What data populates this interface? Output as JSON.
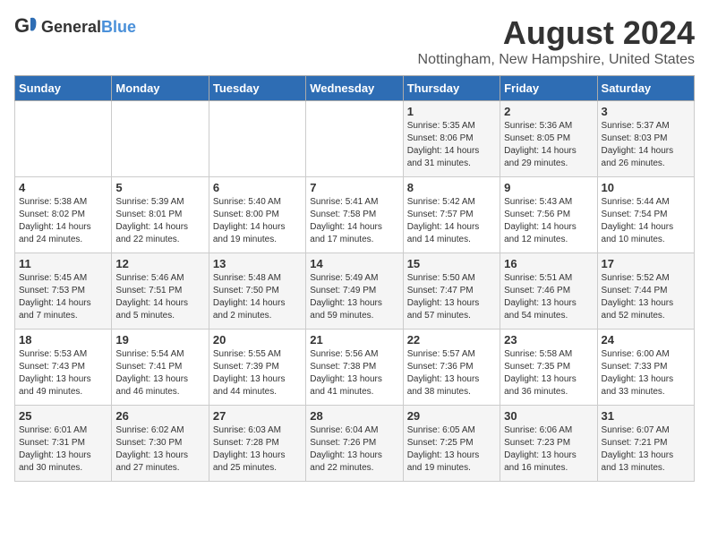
{
  "header": {
    "logo_general": "General",
    "logo_blue": "Blue",
    "month": "August 2024",
    "location": "Nottingham, New Hampshire, United States"
  },
  "weekdays": [
    "Sunday",
    "Monday",
    "Tuesday",
    "Wednesday",
    "Thursday",
    "Friday",
    "Saturday"
  ],
  "weeks": [
    [
      {
        "day": "",
        "info": ""
      },
      {
        "day": "",
        "info": ""
      },
      {
        "day": "",
        "info": ""
      },
      {
        "day": "",
        "info": ""
      },
      {
        "day": "1",
        "info": "Sunrise: 5:35 AM\nSunset: 8:06 PM\nDaylight: 14 hours\nand 31 minutes."
      },
      {
        "day": "2",
        "info": "Sunrise: 5:36 AM\nSunset: 8:05 PM\nDaylight: 14 hours\nand 29 minutes."
      },
      {
        "day": "3",
        "info": "Sunrise: 5:37 AM\nSunset: 8:03 PM\nDaylight: 14 hours\nand 26 minutes."
      }
    ],
    [
      {
        "day": "4",
        "info": "Sunrise: 5:38 AM\nSunset: 8:02 PM\nDaylight: 14 hours\nand 24 minutes."
      },
      {
        "day": "5",
        "info": "Sunrise: 5:39 AM\nSunset: 8:01 PM\nDaylight: 14 hours\nand 22 minutes."
      },
      {
        "day": "6",
        "info": "Sunrise: 5:40 AM\nSunset: 8:00 PM\nDaylight: 14 hours\nand 19 minutes."
      },
      {
        "day": "7",
        "info": "Sunrise: 5:41 AM\nSunset: 7:58 PM\nDaylight: 14 hours\nand 17 minutes."
      },
      {
        "day": "8",
        "info": "Sunrise: 5:42 AM\nSunset: 7:57 PM\nDaylight: 14 hours\nand 14 minutes."
      },
      {
        "day": "9",
        "info": "Sunrise: 5:43 AM\nSunset: 7:56 PM\nDaylight: 14 hours\nand 12 minutes."
      },
      {
        "day": "10",
        "info": "Sunrise: 5:44 AM\nSunset: 7:54 PM\nDaylight: 14 hours\nand 10 minutes."
      }
    ],
    [
      {
        "day": "11",
        "info": "Sunrise: 5:45 AM\nSunset: 7:53 PM\nDaylight: 14 hours\nand 7 minutes."
      },
      {
        "day": "12",
        "info": "Sunrise: 5:46 AM\nSunset: 7:51 PM\nDaylight: 14 hours\nand 5 minutes."
      },
      {
        "day": "13",
        "info": "Sunrise: 5:48 AM\nSunset: 7:50 PM\nDaylight: 14 hours\nand 2 minutes."
      },
      {
        "day": "14",
        "info": "Sunrise: 5:49 AM\nSunset: 7:49 PM\nDaylight: 13 hours\nand 59 minutes."
      },
      {
        "day": "15",
        "info": "Sunrise: 5:50 AM\nSunset: 7:47 PM\nDaylight: 13 hours\nand 57 minutes."
      },
      {
        "day": "16",
        "info": "Sunrise: 5:51 AM\nSunset: 7:46 PM\nDaylight: 13 hours\nand 54 minutes."
      },
      {
        "day": "17",
        "info": "Sunrise: 5:52 AM\nSunset: 7:44 PM\nDaylight: 13 hours\nand 52 minutes."
      }
    ],
    [
      {
        "day": "18",
        "info": "Sunrise: 5:53 AM\nSunset: 7:43 PM\nDaylight: 13 hours\nand 49 minutes."
      },
      {
        "day": "19",
        "info": "Sunrise: 5:54 AM\nSunset: 7:41 PM\nDaylight: 13 hours\nand 46 minutes."
      },
      {
        "day": "20",
        "info": "Sunrise: 5:55 AM\nSunset: 7:39 PM\nDaylight: 13 hours\nand 44 minutes."
      },
      {
        "day": "21",
        "info": "Sunrise: 5:56 AM\nSunset: 7:38 PM\nDaylight: 13 hours\nand 41 minutes."
      },
      {
        "day": "22",
        "info": "Sunrise: 5:57 AM\nSunset: 7:36 PM\nDaylight: 13 hours\nand 38 minutes."
      },
      {
        "day": "23",
        "info": "Sunrise: 5:58 AM\nSunset: 7:35 PM\nDaylight: 13 hours\nand 36 minutes."
      },
      {
        "day": "24",
        "info": "Sunrise: 6:00 AM\nSunset: 7:33 PM\nDaylight: 13 hours\nand 33 minutes."
      }
    ],
    [
      {
        "day": "25",
        "info": "Sunrise: 6:01 AM\nSunset: 7:31 PM\nDaylight: 13 hours\nand 30 minutes."
      },
      {
        "day": "26",
        "info": "Sunrise: 6:02 AM\nSunset: 7:30 PM\nDaylight: 13 hours\nand 27 minutes."
      },
      {
        "day": "27",
        "info": "Sunrise: 6:03 AM\nSunset: 7:28 PM\nDaylight: 13 hours\nand 25 minutes."
      },
      {
        "day": "28",
        "info": "Sunrise: 6:04 AM\nSunset: 7:26 PM\nDaylight: 13 hours\nand 22 minutes."
      },
      {
        "day": "29",
        "info": "Sunrise: 6:05 AM\nSunset: 7:25 PM\nDaylight: 13 hours\nand 19 minutes."
      },
      {
        "day": "30",
        "info": "Sunrise: 6:06 AM\nSunset: 7:23 PM\nDaylight: 13 hours\nand 16 minutes."
      },
      {
        "day": "31",
        "info": "Sunrise: 6:07 AM\nSunset: 7:21 PM\nDaylight: 13 hours\nand 13 minutes."
      }
    ]
  ]
}
